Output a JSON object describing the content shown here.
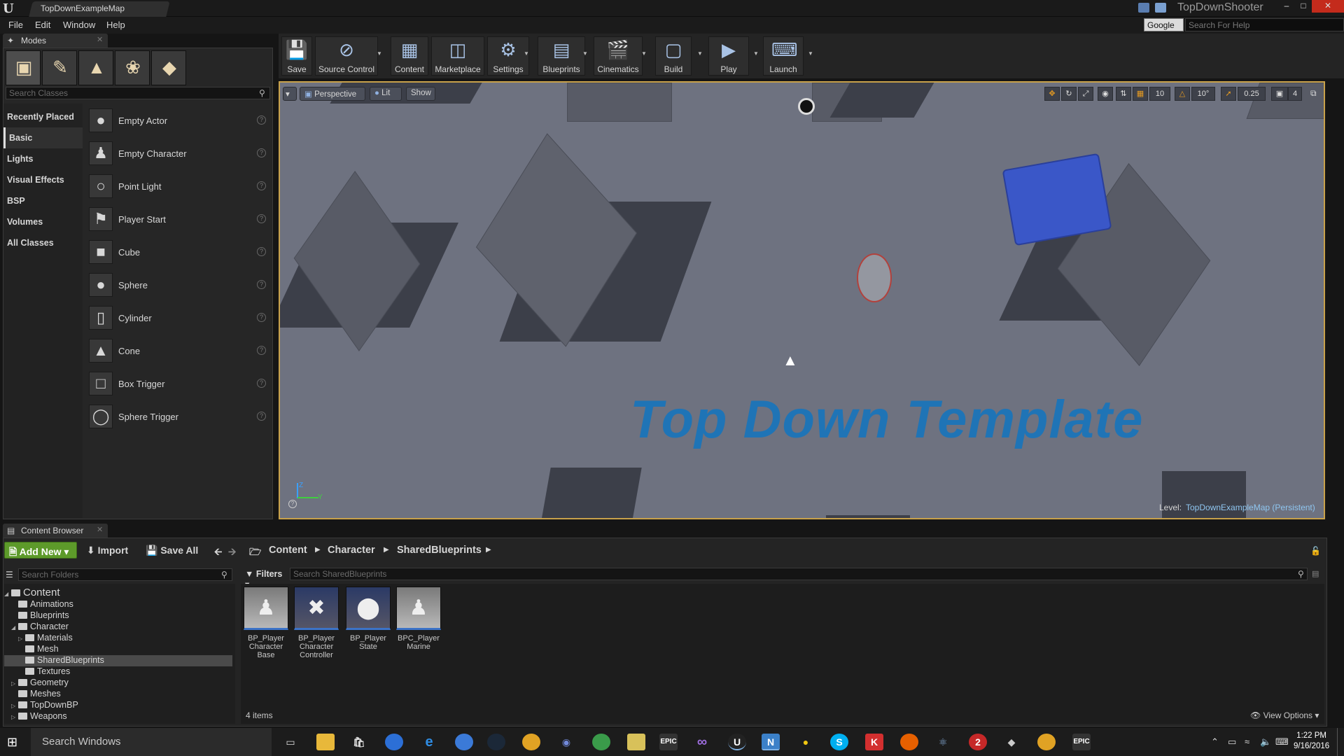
{
  "window": {
    "doc_tab": "TopDownExampleMap",
    "project": "TopDownShooter"
  },
  "menu": [
    "File",
    "Edit",
    "Window",
    "Help"
  ],
  "help_search": {
    "engine": "Google",
    "placeholder": "Search For Help"
  },
  "modes": {
    "tab": "Modes",
    "search_placeholder": "Search Classes",
    "categories": [
      "Recently Placed",
      "Basic",
      "Lights",
      "Visual Effects",
      "BSP",
      "Volumes",
      "All Classes"
    ],
    "selected_category": "Basic",
    "classes": [
      {
        "label": "Empty Actor",
        "icon": "sphere-thumb-icon"
      },
      {
        "label": "Empty Character",
        "icon": "character-thumb-icon"
      },
      {
        "label": "Point Light",
        "icon": "bulb-thumb-icon"
      },
      {
        "label": "Player Start",
        "icon": "player-start-thumb-icon"
      },
      {
        "label": "Cube",
        "icon": "cube-thumb-icon"
      },
      {
        "label": "Sphere",
        "icon": "sphere-thumb-icon"
      },
      {
        "label": "Cylinder",
        "icon": "cylinder-thumb-icon"
      },
      {
        "label": "Cone",
        "icon": "cone-thumb-icon"
      },
      {
        "label": "Box Trigger",
        "icon": "box-trigger-thumb-icon"
      },
      {
        "label": "Sphere Trigger",
        "icon": "sphere-trigger-thumb-icon"
      }
    ]
  },
  "toolbar": [
    {
      "label": "Save",
      "icon": "save-icon"
    },
    {
      "label": "Source Control",
      "icon": "source-control-icon"
    },
    {
      "label": "Content",
      "icon": "content-icon"
    },
    {
      "label": "Marketplace",
      "icon": "marketplace-icon"
    },
    {
      "label": "Settings",
      "icon": "settings-icon"
    },
    {
      "label": "Blueprints",
      "icon": "blueprints-icon"
    },
    {
      "label": "Cinematics",
      "icon": "cinematics-icon"
    },
    {
      "label": "Build",
      "icon": "build-icon"
    },
    {
      "label": "Play",
      "icon": "play-icon"
    },
    {
      "label": "Launch",
      "icon": "launch-icon"
    }
  ],
  "viewport": {
    "perspective": "Perspective",
    "lit": "Lit",
    "show": "Show",
    "grid_snap": "10",
    "rotation_snap": "10°",
    "scale_snap": "0.25",
    "camera_speed": "4",
    "template_text": "Top Down Template",
    "level_prefix": "Level:",
    "level_name": "TopDownExampleMap (Persistent)",
    "axis_z": "Z",
    "axis_y": "Y",
    "border_color": "#c8a14a",
    "template_color": "#1f74b6"
  },
  "content_browser": {
    "tab": "Content Browser",
    "add_new": "Add New",
    "import": "Import",
    "save_all": "Save All",
    "breadcrumbs": [
      "Content",
      "Character",
      "SharedBlueprints"
    ],
    "folder_search_placeholder": "Search Folders",
    "filters": "Filters",
    "asset_search_placeholder": "Search SharedBlueprints",
    "tree": [
      {
        "label": "Content",
        "level": 0,
        "expanded": true
      },
      {
        "label": "Animations",
        "level": 1
      },
      {
        "label": "Blueprints",
        "level": 1
      },
      {
        "label": "Character",
        "level": 1,
        "expanded": true
      },
      {
        "label": "Materials",
        "level": 2,
        "collapsed": true
      },
      {
        "label": "Mesh",
        "level": 2
      },
      {
        "label": "SharedBlueprints",
        "level": 2,
        "selected": true
      },
      {
        "label": "Textures",
        "level": 2
      },
      {
        "label": "Geometry",
        "level": 1,
        "collapsed": true
      },
      {
        "label": "Meshes",
        "level": 1
      },
      {
        "label": "TopDownBP",
        "level": 1,
        "collapsed": true
      },
      {
        "label": "Weapons",
        "level": 1,
        "collapsed": true
      }
    ],
    "assets": [
      {
        "label": "BP_Player Character Base",
        "icon": "character-figure-icon"
      },
      {
        "label": "BP_Player Character Controller",
        "icon": "controller-figure-icon"
      },
      {
        "label": "BP_Player State",
        "icon": "sphere-figure-icon"
      },
      {
        "label": "BPC_Player Marine",
        "icon": "character-figure-icon"
      }
    ],
    "item_count": "4 items",
    "view_options": "View Options"
  },
  "taskbar": {
    "search": "Search Windows",
    "time": "1:22 PM",
    "date": "9/16/2016"
  }
}
